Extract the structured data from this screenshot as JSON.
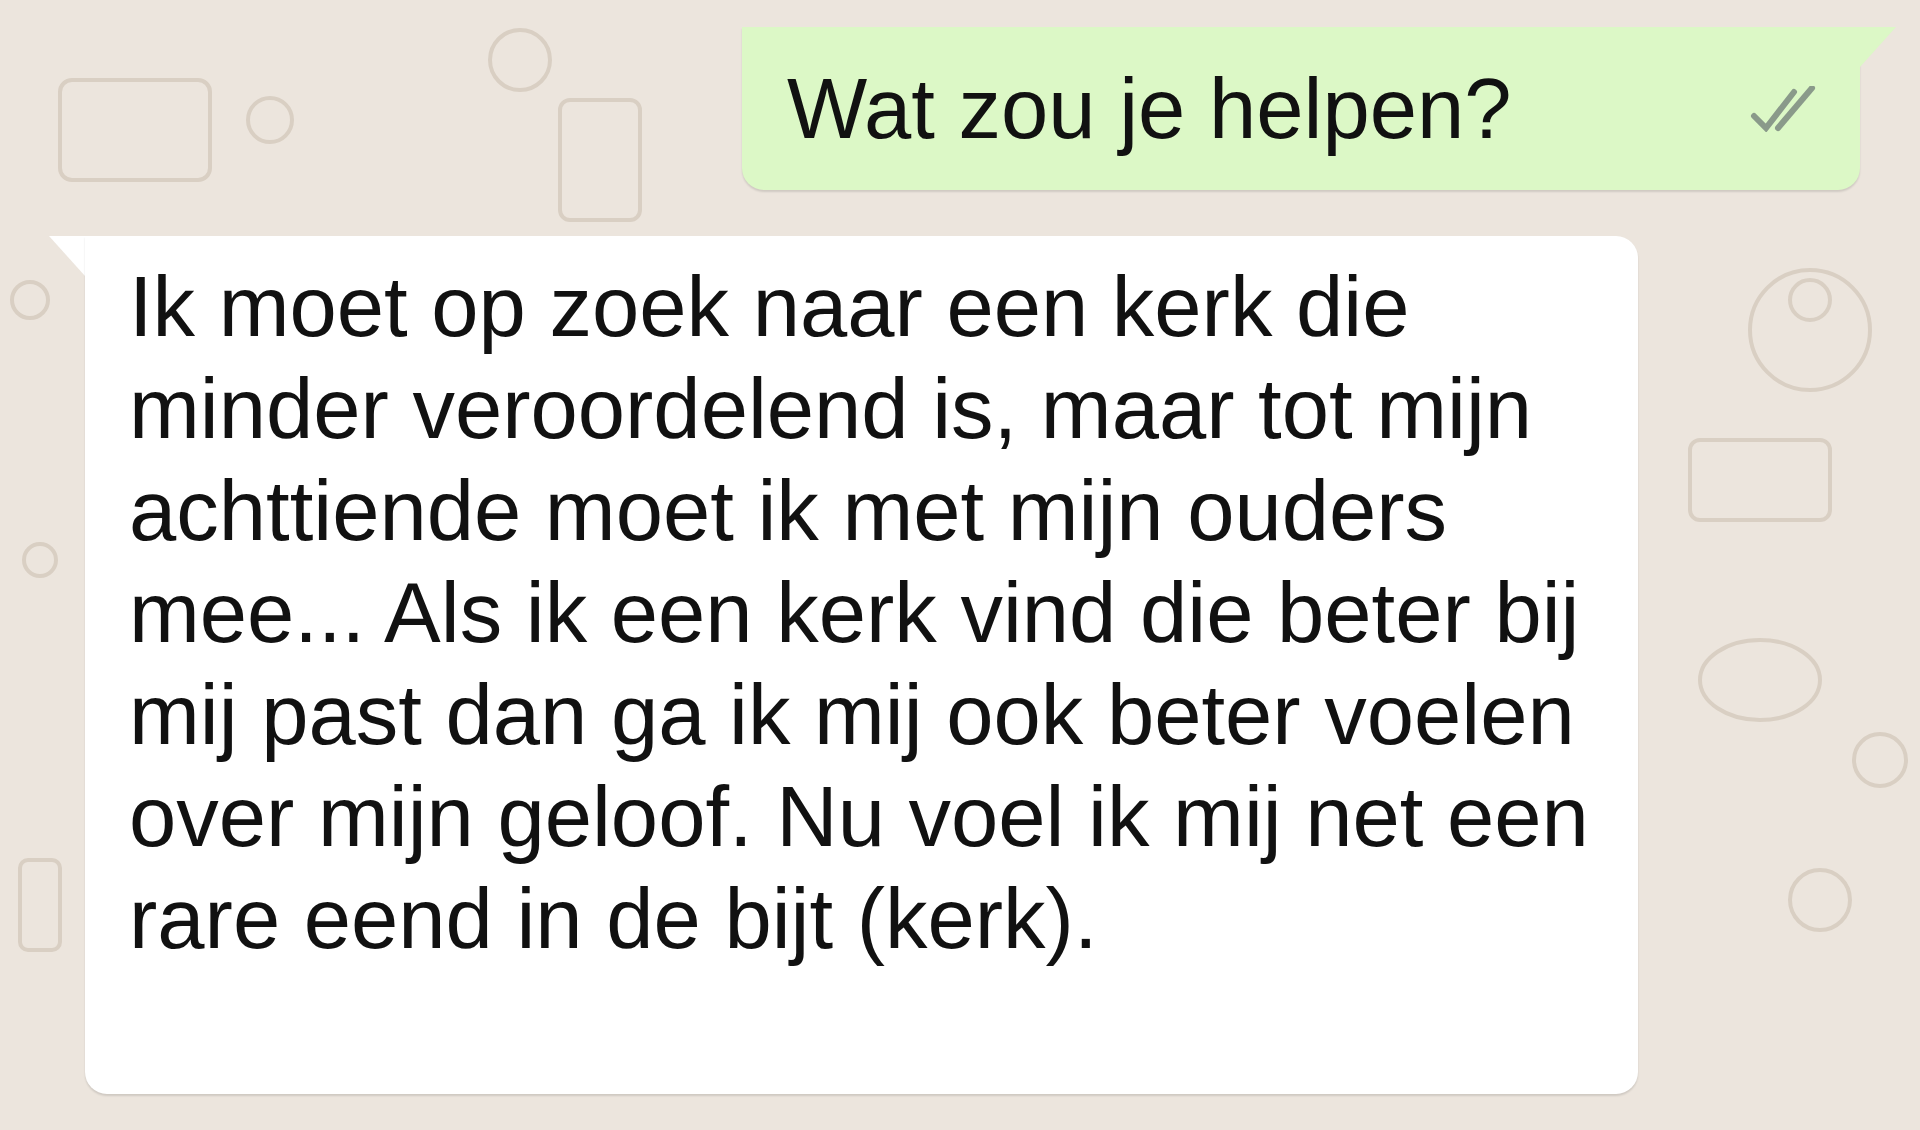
{
  "messages": [
    {
      "kind": "outgoing",
      "text": "Wat zou je helpen?",
      "read": false
    },
    {
      "kind": "incoming",
      "text": "Ik moet op zoek naar een kerk die minder veroordelend is, maar tot mijn achttiende moet ik met mijn ouders mee... Als ik een kerk vind die beter bij mij past dan ga ik mij ook beter voelen over mijn geloof. Nu voel ik mij net een rare eend in de bijt (kerk)."
    }
  ]
}
